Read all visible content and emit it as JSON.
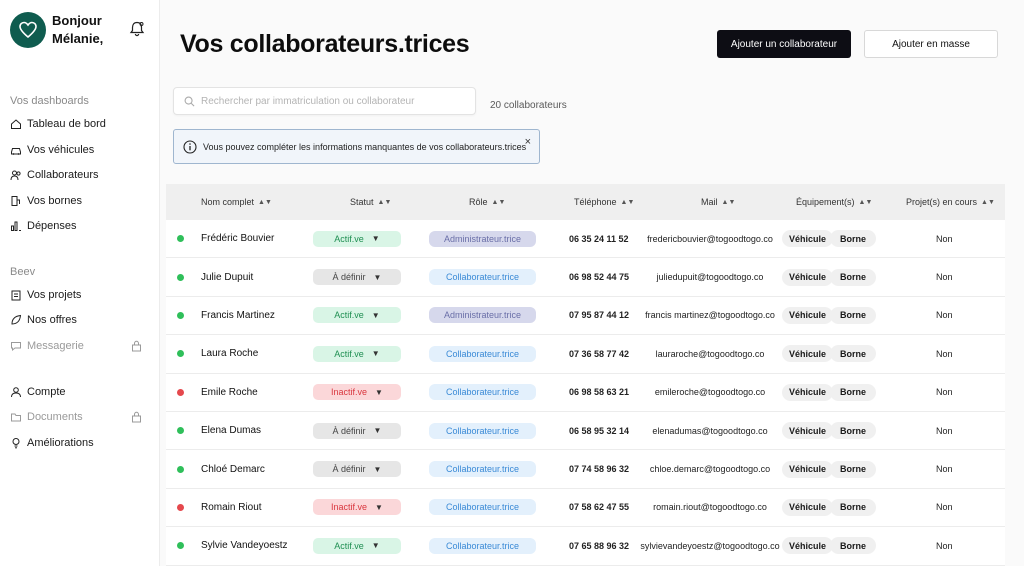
{
  "sidebar": {
    "greeting_line1": "Bonjour",
    "greeting_line2": "Mélanie,",
    "section_dashboards": "Vos dashboards",
    "section_beev": "Beev",
    "items": [
      {
        "label": "Tableau de bord",
        "icon": "home-icon",
        "disabled": false
      },
      {
        "label": "Vos véhicules",
        "icon": "car-icon",
        "disabled": false
      },
      {
        "label": "Collaborateurs",
        "icon": "users-icon",
        "disabled": false
      },
      {
        "label": "Vos bornes",
        "icon": "charger-icon",
        "disabled": false
      },
      {
        "label": "Dépenses",
        "icon": "chart-icon",
        "disabled": false
      },
      {
        "label": "Vos projets",
        "icon": "clipboard-icon",
        "disabled": false
      },
      {
        "label": "Nos offres",
        "icon": "leaf-icon",
        "disabled": false
      },
      {
        "label": "Messagerie",
        "icon": "message-icon",
        "disabled": true
      },
      {
        "label": "Compte",
        "icon": "user-icon",
        "disabled": false
      },
      {
        "label": "Documents",
        "icon": "folder-icon",
        "disabled": true
      },
      {
        "label": "Améliorations",
        "icon": "bulb-icon",
        "disabled": false
      }
    ]
  },
  "header": {
    "title": "Vos collaborateurs.trices",
    "add_button": "Ajouter un collaborateur",
    "bulk_button": "Ajouter en masse"
  },
  "search": {
    "placeholder": "Rechercher par immatriculation ou collaborateur",
    "count": "20 collaborateurs"
  },
  "alert": {
    "message": "Vous pouvez compléter les informations manquantes de vos collaborateurs.trices",
    "close": "×"
  },
  "table": {
    "headers": [
      "Nom complet",
      "Statut",
      "Rôle",
      "Téléphone",
      "Mail",
      "Équipement(s)",
      "Projet(s) en cours"
    ],
    "equip_vehicle": "Véhicule",
    "equip_borne": "Borne",
    "rows": [
      {
        "name": "Frédéric Bouvier",
        "status": "Actif.ve",
        "status_kind": "active",
        "role": "Administrateur.trice",
        "role_kind": "admin",
        "phone": "06 35 24 11 52",
        "mail": "fredericbouvier@togoodtogo.co",
        "projects": "Non",
        "online": true
      },
      {
        "name": "Julie Dupuit",
        "status": "À définir",
        "status_kind": "undefined",
        "role": "Collaborateur.trice",
        "role_kind": "collab",
        "phone": "06 98 52 44 75",
        "mail": "juliedupuit@togoodtogo.co",
        "projects": "Non",
        "online": true
      },
      {
        "name": "Francis Martinez",
        "status": "Actif.ve",
        "status_kind": "active",
        "role": "Administrateur.trice",
        "role_kind": "admin",
        "phone": "07 95 87 44 12",
        "mail": "francis martinez@togoodtogo.co",
        "projects": "Non",
        "online": true
      },
      {
        "name": "Laura Roche",
        "status": "Actif.ve",
        "status_kind": "active",
        "role": "Collaborateur.trice",
        "role_kind": "collab",
        "phone": "07 36 58 77 42",
        "mail": "lauraroche@togoodtogo.co",
        "projects": "Non",
        "online": true
      },
      {
        "name": "Emile Roche",
        "status": "Inactif.ve",
        "status_kind": "inactive",
        "role": "Collaborateur.trice",
        "role_kind": "collab",
        "phone": "06 98 58 63 21",
        "mail": "emileroche@togoodtogo.co",
        "projects": "Non",
        "online": false
      },
      {
        "name": "Elena Dumas",
        "status": "À définir",
        "status_kind": "undefined",
        "role": "Collaborateur.trice",
        "role_kind": "collab",
        "phone": "06 58 95 32 14",
        "mail": "elenadumas@togoodtogo.co",
        "projects": "Non",
        "online": true
      },
      {
        "name": "Chloé Demarc",
        "status": "À définir",
        "status_kind": "undefined",
        "role": "Collaborateur.trice",
        "role_kind": "collab",
        "phone": "07 74 58 96 32",
        "mail": "chloe.demarc@togoodtogo.co",
        "projects": "Non",
        "online": true
      },
      {
        "name": "Romain Riout",
        "status": "Inactif.ve",
        "status_kind": "inactive",
        "role": "Collaborateur.trice",
        "role_kind": "collab",
        "phone": "07 58 62 47 55",
        "mail": "romain.riout@togoodtogo.co",
        "projects": "Non",
        "online": false
      },
      {
        "name": "Sylvie Vandeyoestz",
        "status": "Actif.ve",
        "status_kind": "active",
        "role": "Collaborateur.trice",
        "role_kind": "collab",
        "phone": "07 65 88 96 32",
        "mail": "sylvievandeyoestz@togoodtogo.co",
        "projects": "Non",
        "online": true
      }
    ]
  },
  "colors": {
    "online": "#2fbf5a",
    "offline": "#e5484d",
    "active_bg": "#d9f5e6",
    "active_fg": "#1f8f52",
    "undefined_bg": "#e6e6e6",
    "undefined_fg": "#444444",
    "inactive_bg": "#fbd7d9",
    "inactive_fg": "#d9363e",
    "admin_bg": "#d6d8ec",
    "admin_fg": "#6a6fa8",
    "collab_bg": "#e3f0fc",
    "collab_fg": "#3a8ad6"
  }
}
